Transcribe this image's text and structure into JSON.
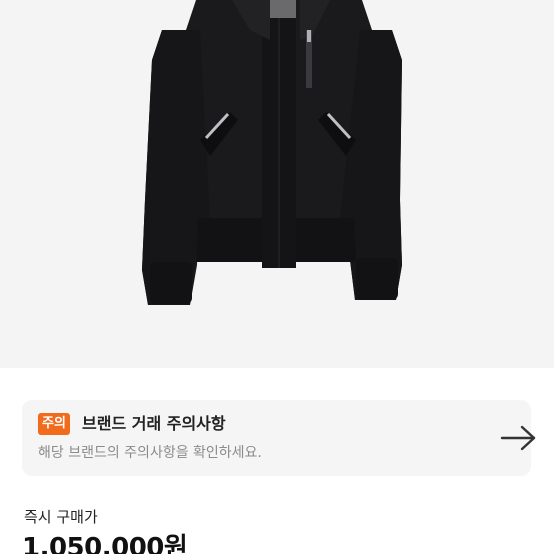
{
  "product": {
    "image_alt": "black bomber down jacket",
    "bg_color": "#f4f4f4"
  },
  "notice": {
    "badge": "주의",
    "title": "브랜드 거래 주의사항",
    "description": "해당 브랜드의 주의사항을 확인하세요.",
    "arrow_icon": "arrow-right-icon",
    "badge_color": "#f26b1d"
  },
  "price": {
    "label": "즉시 구매가",
    "value": "1,050,000원"
  }
}
